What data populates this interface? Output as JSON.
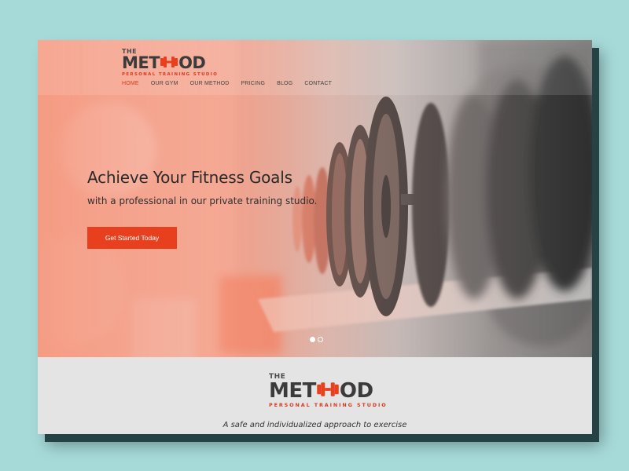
{
  "brand": {
    "the": "THE",
    "word_left": "MET",
    "word_right": "OD",
    "tagline": "PERSONAL TRAINING STUDIO",
    "logo_icon": "dumbbell-icon",
    "accent_color": "#e8401f"
  },
  "nav": {
    "items": [
      {
        "label": "HOME",
        "active": true
      },
      {
        "label": "OUR GYM",
        "active": false
      },
      {
        "label": "OUR METHOD",
        "active": false
      },
      {
        "label": "PRICING",
        "active": false
      },
      {
        "label": "BLOG",
        "active": false
      },
      {
        "label": "CONTACT",
        "active": false
      }
    ]
  },
  "hero": {
    "title": "Achieve Your Fitness Goals",
    "subtitle": "with a professional in our private training studio.",
    "cta_label": "Get Started Today",
    "slides_total": 2,
    "slide_active": 1
  },
  "band": {
    "tagline": "A safe and individualized approach to exercise"
  }
}
